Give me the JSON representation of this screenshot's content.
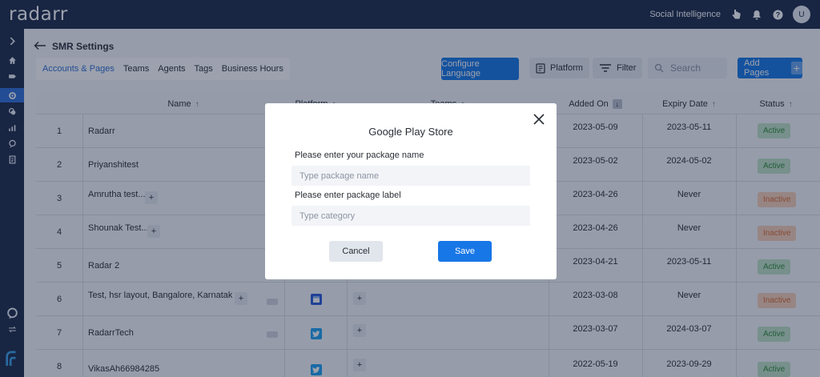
{
  "app": {
    "logo": "radarr"
  },
  "topbar": {
    "context": "Social Intelligence",
    "avatar": "U"
  },
  "page": {
    "title": "SMR Settings"
  },
  "tabs": [
    "Accounts & Pages",
    "Teams",
    "Agents",
    "Tags",
    "Business Hours"
  ],
  "toolbar": {
    "configure_language": "Configure Language",
    "platform": "Platform",
    "filter": "Filter",
    "search_placeholder": "Search",
    "add_pages": "Add Pages"
  },
  "table": {
    "headers": [
      "Name",
      "Platform",
      "Teams",
      "Added On",
      "Expiry Date",
      "Status"
    ],
    "rows": [
      {
        "index": "1",
        "name": "Radarr",
        "added": "2023-05-09",
        "expiry": "2023-05-11",
        "status": "Active"
      },
      {
        "index": "2",
        "name": "Priyanshitest",
        "added": "2023-05-02",
        "expiry": "2024-05-02",
        "status": "Active"
      },
      {
        "index": "3",
        "name": "Amrutha test...",
        "added": "2023-04-26",
        "expiry": "Never",
        "status": "Inactive"
      },
      {
        "index": "4",
        "name": "Shounak Test...",
        "added": "2023-04-26",
        "expiry": "Never",
        "status": "Inactive"
      },
      {
        "index": "5",
        "name": "Radar 2",
        "added": "2023-04-21",
        "expiry": "2023-05-11",
        "status": "Active"
      },
      {
        "index": "6",
        "name": "Test, hsr layout, Bangalore, Karnataka...",
        "added": "2023-03-08",
        "expiry": "Never",
        "status": "Inactive"
      },
      {
        "index": "7",
        "name": "RadarrTech",
        "added": "2023-03-07",
        "expiry": "2024-03-07",
        "status": "Active"
      },
      {
        "index": "8",
        "name": "VikasAh66984285",
        "added": "2022-05-19",
        "expiry": "2023-09-29",
        "status": "Active"
      }
    ]
  },
  "modal": {
    "title": "Google Play Store",
    "package_name_label": "Please enter your package name",
    "package_name_placeholder": "Type package name",
    "package_label_label": "Please enter package label",
    "package_label_placeholder": "Type category",
    "cancel": "Cancel",
    "save": "Save"
  },
  "colors": {
    "primary": "#1877e6",
    "nav": "#1d2a49",
    "active": "#2f8a3a",
    "inactive": "#d9692b"
  }
}
